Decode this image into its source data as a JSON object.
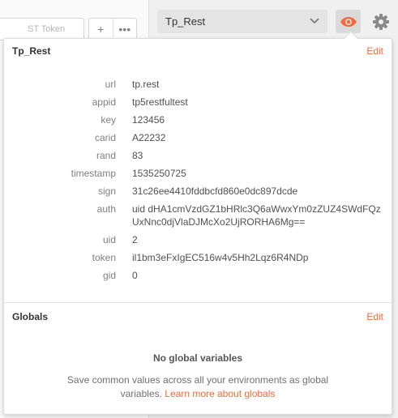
{
  "background": {
    "token_placeholder": "ST Token",
    "add_glyph": "+",
    "more_glyph": "•••"
  },
  "header": {
    "environment_selected": "Tp_Rest",
    "accent": "#f26b3a"
  },
  "environment": {
    "name": "Tp_Rest",
    "edit_label": "Edit",
    "variables": [
      {
        "key": "url",
        "value": "tp.rest"
      },
      {
        "key": "appid",
        "value": "tp5restfultest"
      },
      {
        "key": "key",
        "value": "123456"
      },
      {
        "key": "carid",
        "value": "A22232"
      },
      {
        "key": "rand",
        "value": "83"
      },
      {
        "key": "timestamp",
        "value": "1535250725"
      },
      {
        "key": "sign",
        "value": "31c26ee4410fddbcfd860e0dc897dcde"
      },
      {
        "key": "auth",
        "value": "uid dHA1cmVzdGZ1bHRlc3Q6aWwxYm0zZUZ4SWdFQzUxNnc0djVlaDJMcXo2UjRORHA6Mg=="
      },
      {
        "key": "uid",
        "value": "2"
      },
      {
        "key": "token",
        "value": "il1bm3eFxIgEC516w4v5Hh2Lqz6R4NDp"
      },
      {
        "key": "gid",
        "value": "0"
      }
    ]
  },
  "globals": {
    "title": "Globals",
    "edit_label": "Edit",
    "empty_title": "No global variables",
    "empty_desc": "Save common values across all your environments as global variables.",
    "learn_link": "Learn more about globals"
  }
}
